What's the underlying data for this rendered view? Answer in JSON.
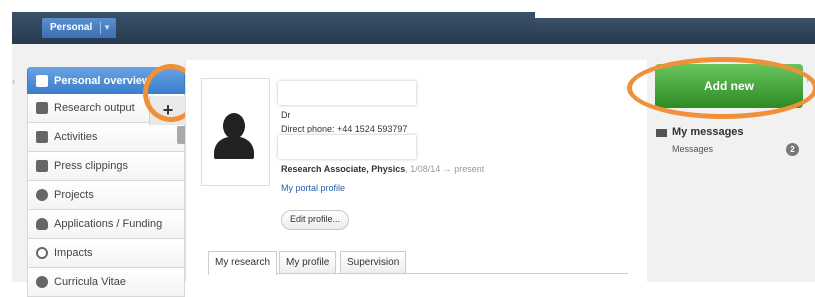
{
  "header": {
    "tab_label": "Personal",
    "tab_caret": "▼"
  },
  "sidebar": {
    "items": [
      {
        "label": "Personal overview",
        "icon": "person-icon"
      },
      {
        "label": "Research output",
        "icon": "book-icon"
      },
      {
        "label": "Activities",
        "icon": "briefcase-icon"
      },
      {
        "label": "Press clippings",
        "icon": "newspaper-icon"
      },
      {
        "label": "Projects",
        "icon": "gear-icon"
      },
      {
        "label": "Applications / Funding",
        "icon": "moneybag-icon"
      },
      {
        "label": "Impacts",
        "icon": "target-icon"
      },
      {
        "label": "Curricula Vitae",
        "icon": "globe-icon"
      }
    ],
    "plus_label": "+"
  },
  "profile": {
    "title": "Dr",
    "phone": "Direct phone: +44 1524 593797",
    "role": "Research Associate, Physics",
    "role_dates": ", 1/08/14 → present",
    "portal_link": "My portal profile",
    "edit_button": "Edit profile..."
  },
  "tabs": [
    "My research",
    "My profile",
    "Supervision"
  ],
  "right_panel": {
    "add_new": "Add new",
    "messages_title": "My messages",
    "messages_label": "Messages",
    "messages_count": "2"
  },
  "colors": {
    "accent_orange": "#f0913a",
    "add_green": "#3f9f33",
    "nav_blue": "#3b7fcb",
    "topbar": "#2f4359"
  }
}
